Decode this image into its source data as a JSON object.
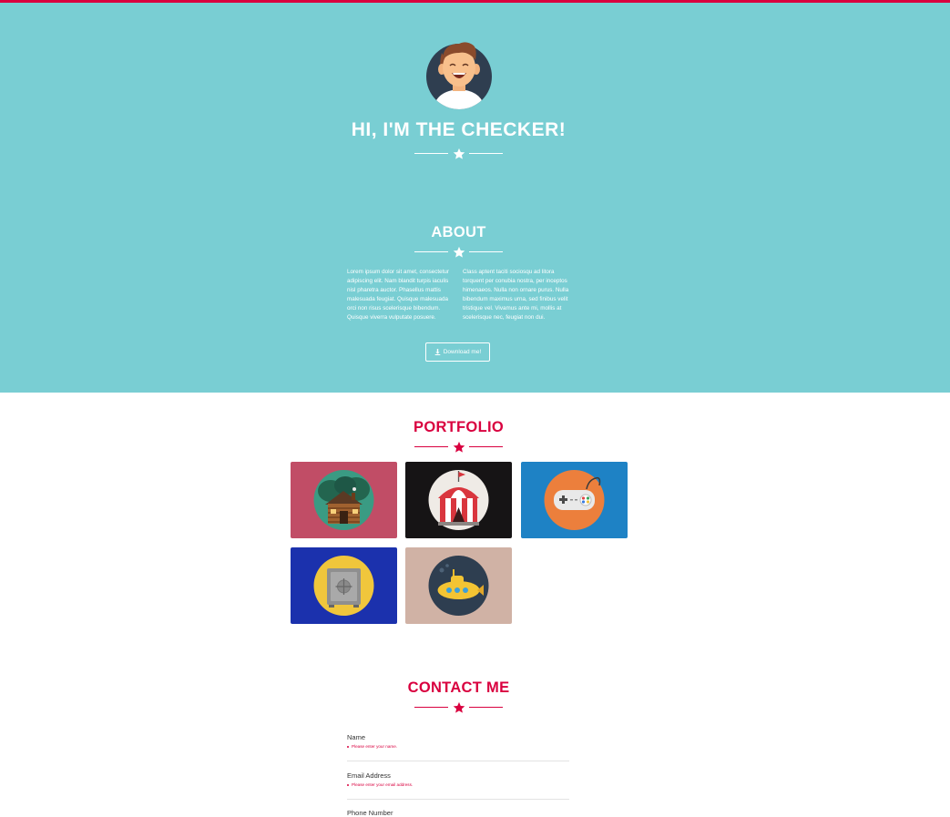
{
  "hero": {
    "title": "HI, I'M THE CHECKER!",
    "background_color": "#79ced3",
    "accent_color": "#d9003f"
  },
  "about": {
    "title": "ABOUT",
    "paragraph_left": "Lorem ipsum dolor sit amet, consectetur adipiscing elit. Nam blandit turpis iaculis nisl pharetra auctor. Phasellus mattis malesuada feugiat. Quisque malesuada orci non risus scelerisque bibendum. Quisque viverra vulputate posuere.",
    "paragraph_right": "Class aptent taciti sociosqu ad litora torquent per conubia nostra, per inceptos himenaeos. Nulla non ornare purus. Nulla bibendum maximus urna, sed finibus velit tristique vel. Vivamus ante mi, mollis at scelerisque nec, feugiat non dui.",
    "download_label": "Download me!",
    "download_icon": "download-icon"
  },
  "portfolio": {
    "title": "PORTFOLIO",
    "items": [
      {
        "icon": "cabin-icon",
        "background": "#c14d66"
      },
      {
        "icon": "circus-tent-icon",
        "background": "#161415"
      },
      {
        "icon": "game-controller-icon",
        "background": "#1e82c5"
      },
      {
        "icon": "safe-icon",
        "background": "#1b31ad"
      },
      {
        "icon": "submarine-icon",
        "background": "#d0b2a5"
      }
    ]
  },
  "contact": {
    "title": "CONTACT ME",
    "fields": [
      {
        "label": "Name",
        "error": "Please enter your name."
      },
      {
        "label": "Email Address",
        "error": "Please enter your email address."
      },
      {
        "label": "Phone Number",
        "error": ""
      }
    ]
  }
}
